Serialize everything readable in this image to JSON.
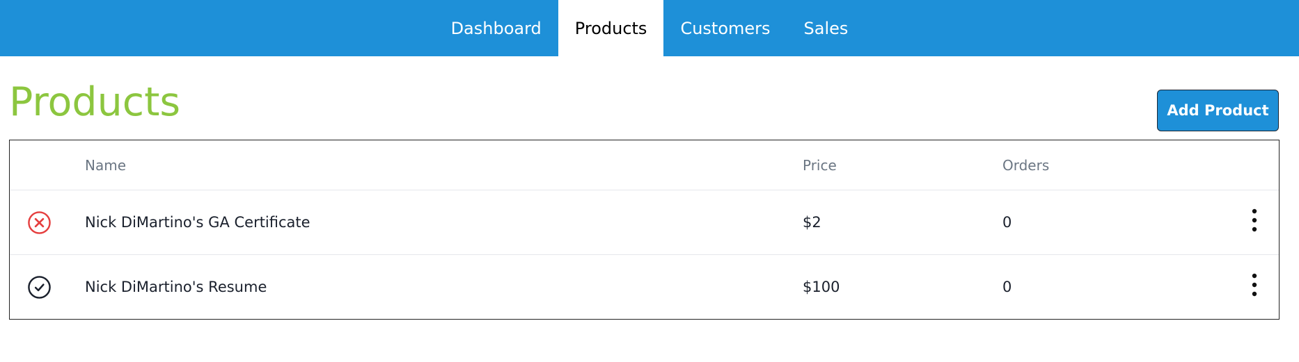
{
  "nav": {
    "tabs": [
      {
        "label": "Dashboard"
      },
      {
        "label": "Products",
        "active": true
      },
      {
        "label": "Customers"
      },
      {
        "label": "Sales"
      }
    ],
    "bg_color": "#1e90d8"
  },
  "page": {
    "title": "Products",
    "title_color": "#8cc63f",
    "add_button_label": "Add Product"
  },
  "table": {
    "columns": [
      "Name",
      "Price",
      "Orders"
    ],
    "rows": [
      {
        "status_icon": "x-circle-icon",
        "status_color": "#e53e3e",
        "name": "Nick DiMartino's GA Certificate",
        "price": "$2",
        "orders": "0"
      },
      {
        "status_icon": "check-circle-icon",
        "status_color": "#1a202c",
        "name": "Nick DiMartino's Resume",
        "price": "$100",
        "orders": "0"
      }
    ],
    "row_menu_icon": "kebab-menu-icon"
  }
}
